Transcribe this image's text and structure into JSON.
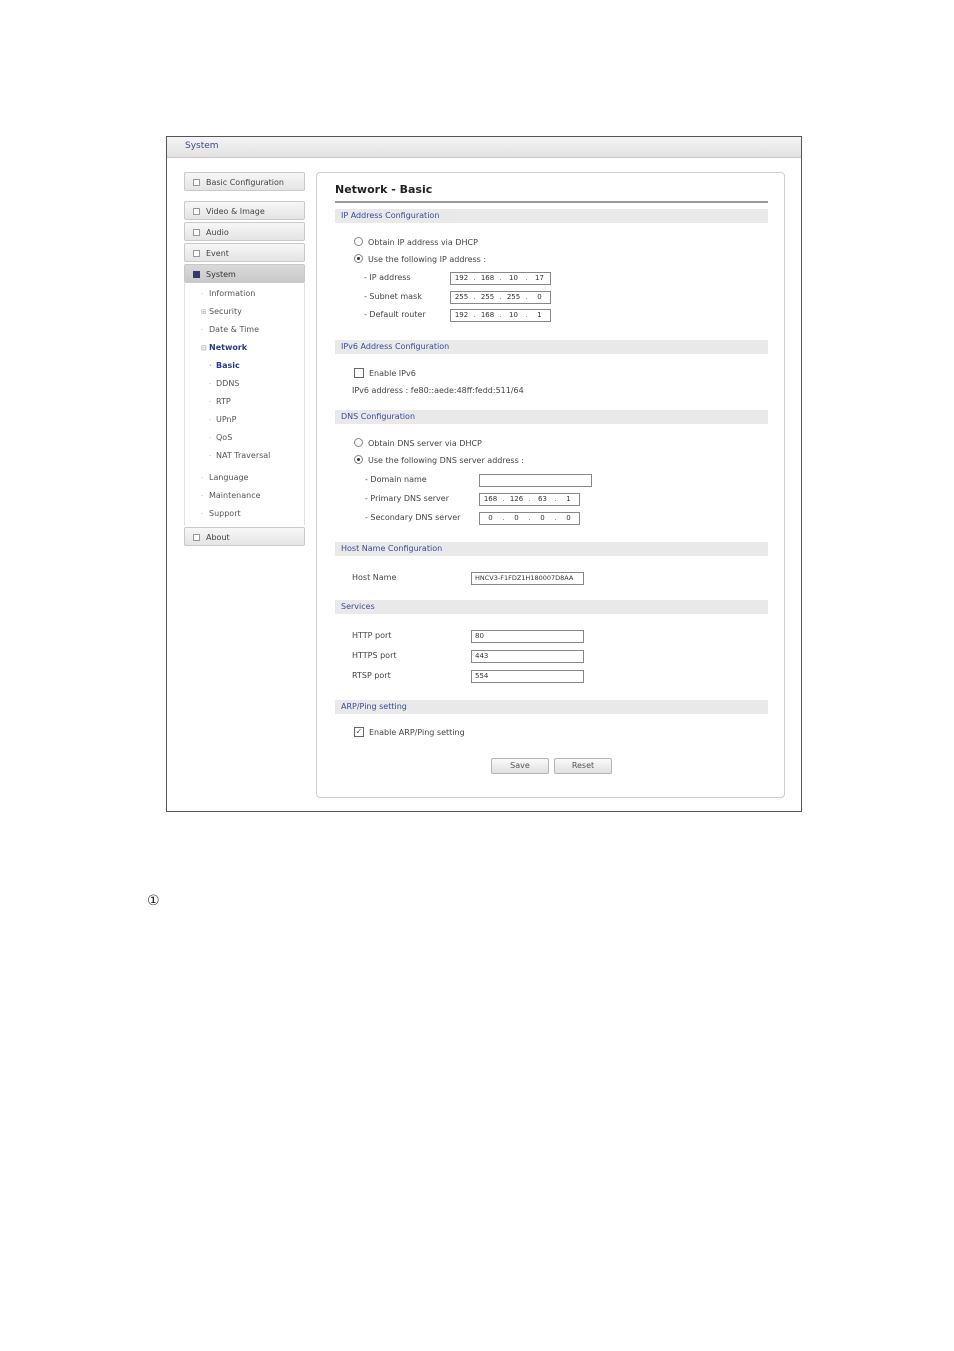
{
  "window": {
    "title": "System"
  },
  "sidebar": {
    "top_items": [
      {
        "label": "Basic Configuration"
      }
    ],
    "items": [
      {
        "label": "Video & Image"
      },
      {
        "label": "Audio"
      },
      {
        "label": "Event"
      },
      {
        "label": "System"
      }
    ],
    "system_sub": [
      {
        "label": "Information"
      },
      {
        "label": "Security"
      },
      {
        "label": "Date & Time"
      },
      {
        "label": "Network"
      }
    ],
    "network_sub": [
      {
        "label": "Basic"
      },
      {
        "label": "DDNS"
      },
      {
        "label": "RTP"
      },
      {
        "label": "UPnP"
      },
      {
        "label": "QoS"
      },
      {
        "label": "NAT Traversal"
      }
    ],
    "system_sub_after": [
      {
        "label": "Language"
      },
      {
        "label": "Maintenance"
      },
      {
        "label": "Support"
      }
    ],
    "about": {
      "label": "About"
    }
  },
  "main": {
    "title": "Network - Basic",
    "ip_section": {
      "header": "IP Address Configuration",
      "dhcp_label": "Obtain IP address via DHCP",
      "static_label": "Use the following IP address :",
      "ip_label": "- IP address",
      "ip": [
        "192",
        "168",
        "10",
        "17"
      ],
      "mask_label": "- Subnet mask",
      "mask": [
        "255",
        "255",
        "255",
        "0"
      ],
      "router_label": "- Default router",
      "router": [
        "192",
        "168",
        "10",
        "1"
      ]
    },
    "ipv6_section": {
      "header": "IPv6 Address Configuration",
      "enable_label": "Enable IPv6",
      "address_text": "IPv6 address : fe80::aede:48ff:fedd:511/64"
    },
    "dns_section": {
      "header": "DNS Configuration",
      "dhcp_label": "Obtain DNS server via DHCP",
      "static_label": "Use the following DNS server address :",
      "domain_label": "- Domain name",
      "domain_value": "",
      "primary_label": "- Primary DNS server",
      "primary": [
        "168",
        "126",
        "63",
        "1"
      ],
      "secondary_label": "- Secondary DNS server",
      "secondary": [
        "0",
        "0",
        "0",
        "0"
      ]
    },
    "host_section": {
      "header": "Host Name Configuration",
      "label": "Host Name",
      "value": "HNCV3-F1FDZ1H180007D8AA"
    },
    "services_section": {
      "header": "Services",
      "http_label": "HTTP port",
      "http_value": "80",
      "https_label": "HTTPS port",
      "https_value": "443",
      "rtsp_label": "RTSP port",
      "rtsp_value": "554"
    },
    "arp_section": {
      "header": "ARP/Ping setting",
      "enable_label": "Enable ARP/Ping setting"
    },
    "buttons": {
      "save": "Save",
      "reset": "Reset"
    }
  },
  "footnote_marker": "①"
}
